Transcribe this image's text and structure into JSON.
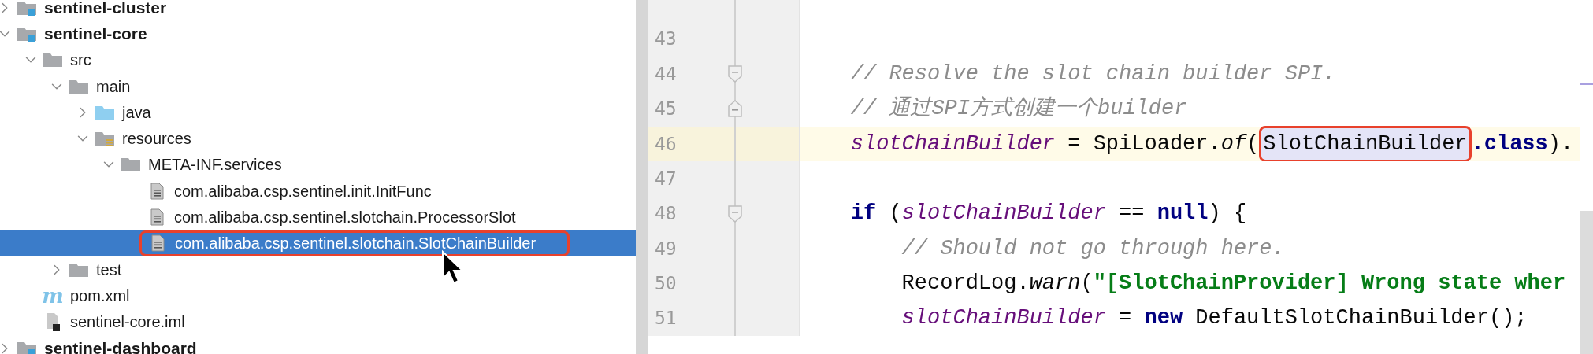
{
  "project_tree": {
    "items": [
      {
        "label": "sentinel-cluster",
        "kind": "module",
        "expanded": false,
        "selected": false,
        "annotated": false
      },
      {
        "label": "sentinel-core",
        "kind": "module",
        "expanded": true,
        "selected": false,
        "annotated": false,
        "children": [
          {
            "label": "src",
            "kind": "folder",
            "expanded": true,
            "selected": false,
            "annotated": false,
            "children": [
              {
                "label": "main",
                "kind": "folder",
                "expanded": true,
                "selected": false,
                "annotated": false,
                "children": [
                  {
                    "label": "java",
                    "kind": "source-folder",
                    "expanded": false,
                    "selected": false,
                    "annotated": false
                  },
                  {
                    "label": "resources",
                    "kind": "resources-folder",
                    "expanded": true,
                    "selected": false,
                    "annotated": false,
                    "children": [
                      {
                        "label": "META-INF.services",
                        "kind": "folder",
                        "expanded": true,
                        "selected": false,
                        "annotated": false,
                        "children": [
                          {
                            "label": "com.alibaba.csp.sentinel.init.InitFunc",
                            "kind": "file",
                            "selected": false,
                            "annotated": false
                          },
                          {
                            "label": "com.alibaba.csp.sentinel.slotchain.ProcessorSlot",
                            "kind": "file",
                            "selected": false,
                            "annotated": false
                          },
                          {
                            "label": "com.alibaba.csp.sentinel.slotchain.SlotChainBuilder",
                            "kind": "file",
                            "selected": true,
                            "annotated": true
                          }
                        ]
                      }
                    ]
                  }
                ]
              },
              {
                "label": "test",
                "kind": "folder",
                "expanded": false,
                "selected": false,
                "annotated": false
              }
            ]
          },
          {
            "label": "pom.xml",
            "kind": "maven",
            "icon_text": "m",
            "selected": false,
            "annotated": false
          },
          {
            "label": "sentinel-core.iml",
            "kind": "iml",
            "selected": false,
            "annotated": false
          }
        ]
      },
      {
        "label": "sentinel-dashboard",
        "kind": "module",
        "expanded": false,
        "selected": false,
        "annotated": false
      }
    ]
  },
  "editor": {
    "lines": [
      {
        "number": "43",
        "current": false
      },
      {
        "number": "44",
        "current": false,
        "fold": {
          "kind": "start"
        },
        "tokens": [
          {
            "kind": "comment",
            "text": "    // Resolve the slot chain builder SPI."
          }
        ]
      },
      {
        "number": "45",
        "current": false,
        "fold": {
          "kind": "end"
        },
        "tokens": [
          {
            "kind": "comment",
            "text": "    // 通过SPI方式创建一个builder"
          }
        ]
      },
      {
        "number": "46",
        "current": true,
        "tokens": [
          {
            "kind": "field",
            "text": "    slotChainBuilder"
          },
          {
            "kind": "plain",
            "text": " = SpiLoader."
          },
          {
            "kind": "method",
            "text": "of"
          },
          {
            "kind": "plain",
            "text": "("
          },
          {
            "kind": "plain",
            "text": "SlotChainBuilder",
            "boxed": true
          },
          {
            "kind": "keyword",
            "text": ".class"
          },
          {
            "kind": "plain",
            "text": ")."
          }
        ]
      },
      {
        "number": "47",
        "current": false
      },
      {
        "number": "48",
        "current": false,
        "fold": {
          "kind": "start"
        },
        "tokens": [
          {
            "kind": "keyword",
            "text": "    if"
          },
          {
            "kind": "plain",
            "text": " ("
          },
          {
            "kind": "field",
            "text": "slotChainBuilder"
          },
          {
            "kind": "plain",
            "text": " == "
          },
          {
            "kind": "keyword",
            "text": "null"
          },
          {
            "kind": "plain",
            "text": ") {"
          }
        ]
      },
      {
        "number": "49",
        "current": false,
        "tokens": [
          {
            "kind": "comment",
            "text": "        // Should not go through here."
          }
        ]
      },
      {
        "number": "50",
        "current": false,
        "tokens": [
          {
            "kind": "plain",
            "text": "        RecordLog."
          },
          {
            "kind": "method",
            "text": "warn"
          },
          {
            "kind": "plain",
            "text": "("
          },
          {
            "kind": "string",
            "text": "\"[SlotChainProvider] Wrong state wher"
          }
        ]
      },
      {
        "number": "51",
        "current": false,
        "tokens": [
          {
            "kind": "field",
            "text": "        slotChainBuilder"
          },
          {
            "kind": "plain",
            "text": " = "
          },
          {
            "kind": "keyword",
            "text": "new"
          },
          {
            "kind": "plain",
            "text": " DefaultSlotChainBuilder();"
          }
        ]
      }
    ]
  }
}
